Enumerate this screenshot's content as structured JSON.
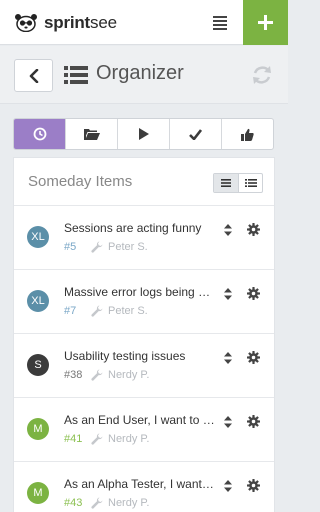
{
  "header": {
    "brand_bold": "sprint",
    "brand_rest": "see",
    "icons": {
      "logo": "panda-glasses-logo-icon",
      "menu": "hamburger-menu-icon",
      "add": "plus-icon"
    },
    "accent": "#7cb342"
  },
  "titlebar": {
    "title": "Organizer",
    "icons": {
      "back": "chevron-left-icon",
      "title": "list-icon",
      "refresh": "refresh-icon"
    }
  },
  "filters": {
    "active_color": "#9b7ec7",
    "tabs": [
      {
        "icon": "clock-icon",
        "active": true
      },
      {
        "icon": "folder-icon",
        "active": false
      },
      {
        "icon": "play-icon",
        "active": false
      },
      {
        "icon": "check-icon",
        "active": false
      },
      {
        "icon": "thumbs-up-icon",
        "active": false
      }
    ]
  },
  "panel": {
    "title": "Someday Items",
    "view_icons": [
      "compact-list-icon",
      "detailed-list-icon"
    ]
  },
  "items": [
    {
      "initials": "XL",
      "avatar_color": "#5b8fa8",
      "title": "Sessions are acting funny",
      "id": "#5",
      "id_color": "#7aa7c7",
      "owner": "Peter S."
    },
    {
      "initials": "XL",
      "avatar_color": "#5b8fa8",
      "title": "Massive error logs being generated",
      "id": "#7",
      "id_color": "#7aa7c7",
      "owner": "Peter S."
    },
    {
      "initials": "S",
      "avatar_color": "#3b3b3b",
      "title": "Usability testing issues",
      "id": "#38",
      "id_color": "#777777",
      "owner": "Nerdy P."
    },
    {
      "initials": "M",
      "avatar_color": "#7cb342",
      "title": "As an End User, I want to import data",
      "id": "#41",
      "id_color": "#8cc152",
      "owner": "Nerdy P."
    },
    {
      "initials": "M",
      "avatar_color": "#7cb342",
      "title": "As an Alpha Tester, I want to report bugs",
      "id": "#43",
      "id_color": "#8cc152",
      "owner": "Nerdy P."
    }
  ]
}
